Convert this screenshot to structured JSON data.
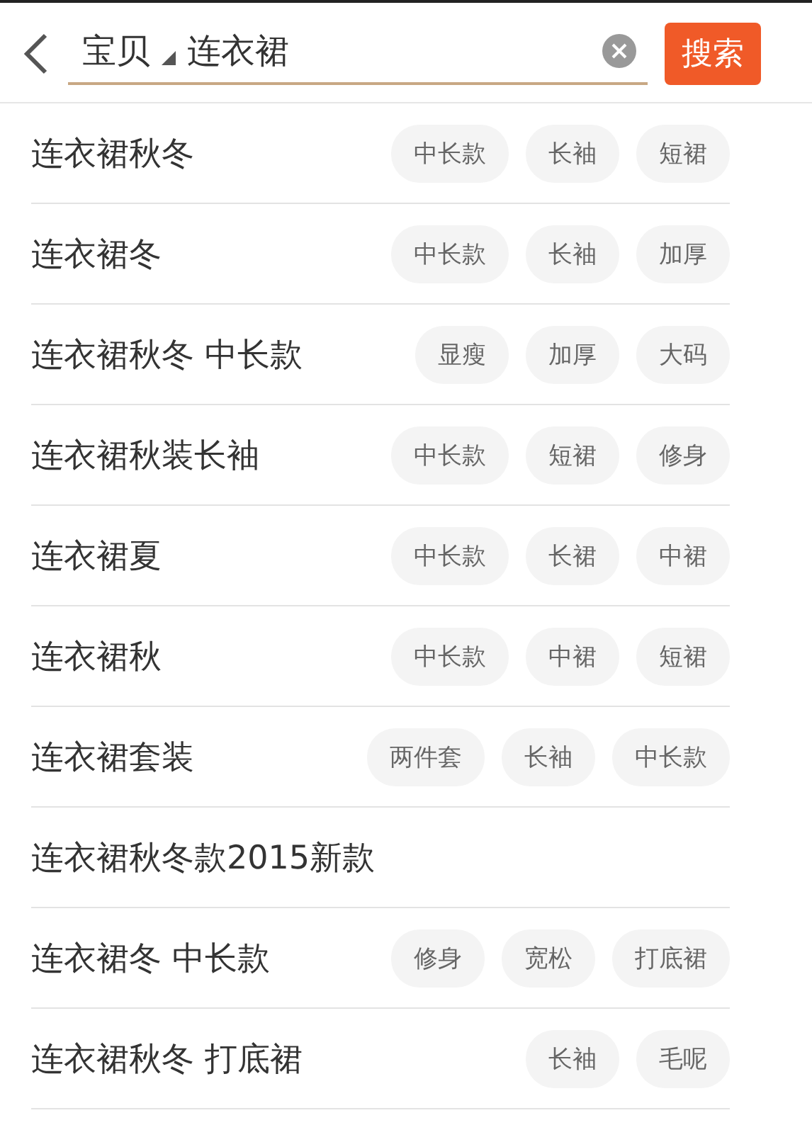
{
  "search_bar": {
    "scope": "宝贝",
    "query": "连衣裙",
    "button": "搜索"
  },
  "suggestions": [
    {
      "text": "连衣裙秋冬",
      "tags": [
        "中长款",
        "长袖",
        "短裙"
      ]
    },
    {
      "text": "连衣裙冬",
      "tags": [
        "中长款",
        "长袖",
        "加厚"
      ]
    },
    {
      "text": "连衣裙秋冬 中长款",
      "tags": [
        "显瘦",
        "加厚",
        "大码"
      ]
    },
    {
      "text": "连衣裙秋装长袖",
      "tags": [
        "中长款",
        "短裙",
        "修身"
      ]
    },
    {
      "text": "连衣裙夏",
      "tags": [
        "中长款",
        "长裙",
        "中裙"
      ]
    },
    {
      "text": "连衣裙秋",
      "tags": [
        "中长款",
        "中裙",
        "短裙"
      ]
    },
    {
      "text": "连衣裙套装",
      "tags": [
        "两件套",
        "长袖",
        "中长款"
      ]
    },
    {
      "text": "连衣裙秋冬款2015新款"
    },
    {
      "text": "连衣裙冬 中长款",
      "tags": [
        "修身",
        "宽松",
        "打底裙"
      ]
    },
    {
      "text": "连衣裙秋冬 打底裙",
      "tags": [
        "长袖",
        "毛呢"
      ]
    }
  ]
}
